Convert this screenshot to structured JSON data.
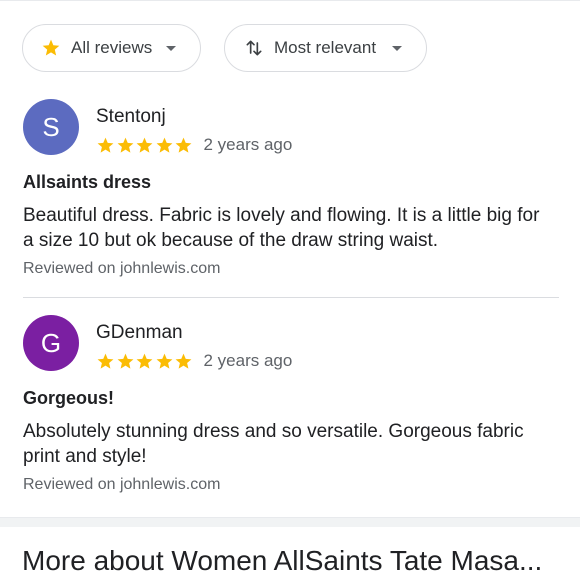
{
  "filters": {
    "rating_filter": {
      "label": "All reviews",
      "icon": "star-icon"
    },
    "sort": {
      "label": "Most relevant",
      "icon": "sort-icon"
    }
  },
  "reviews": [
    {
      "avatar_letter": "S",
      "avatar_color": "#5c6bc0",
      "author": "Stentonj",
      "rating": 5,
      "date": "2 years ago",
      "title": "Allsaints dress",
      "body": "Beautiful dress. Fabric is lovely and flowing. It is a little big for a size 10 but ok because of the draw string waist.",
      "source": "Reviewed on johnlewis.com"
    },
    {
      "avatar_letter": "G",
      "avatar_color": "#7b1fa2",
      "author": "GDenman",
      "rating": 5,
      "date": "2 years ago",
      "title": "Gorgeous!",
      "body": "Absolutely stunning dress and so versatile. Gorgeous fabric print and style!",
      "source": "Reviewed on johnlewis.com"
    }
  ],
  "more_section": {
    "heading": "More about Women AllSaints Tate Masa..."
  },
  "colors": {
    "star": "#fbbc04",
    "muted_text": "#5f6368",
    "border": "#dadce0"
  }
}
